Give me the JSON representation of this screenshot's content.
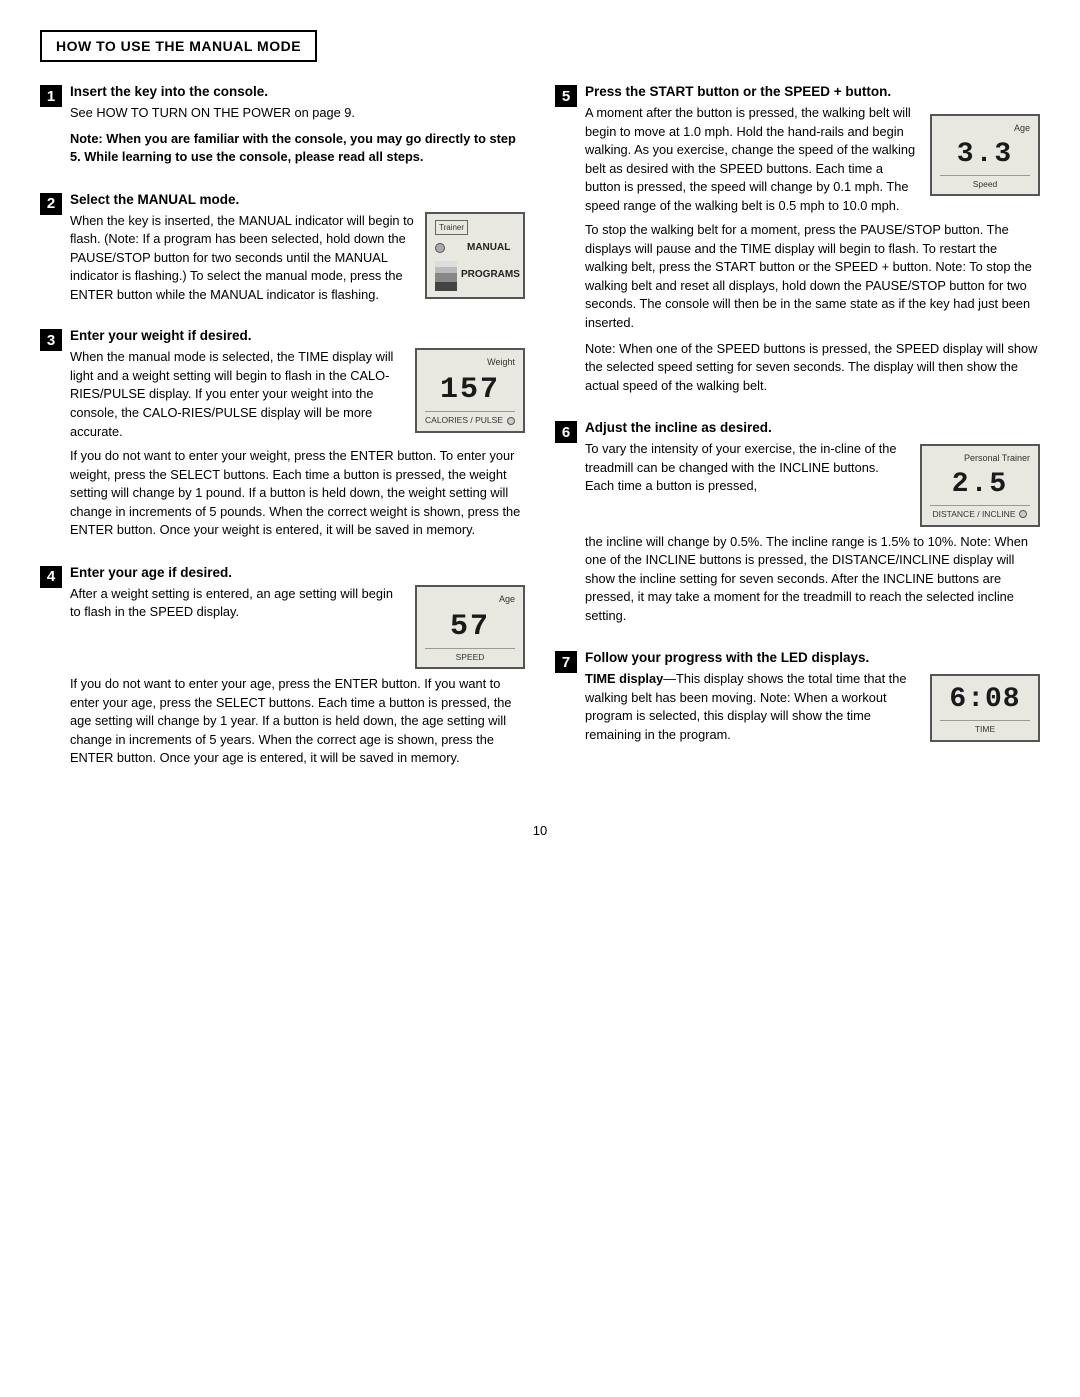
{
  "header": {
    "title": "HOW TO USE THE MANUAL MODE"
  },
  "steps": {
    "step1": {
      "title": "Insert the key into the console.",
      "body1": "See HOW TO TURN ON THE POWER on page 9.",
      "body2": "Note: When you are familiar with the console, you may go directly to step 5. While learning to use the console, please read all steps."
    },
    "step2": {
      "title": "Select the MANUAL mode.",
      "body1": "When the key is inserted, the MANUAL indicator will begin to flash. (Note: If a program has been selected, hold down the PAUSE/STOP button for two seconds until the MANUAL indicator is flashing.) To select the manual mode, press the ENTER button while the MANUAL indicator is flashing.",
      "display": {
        "trainer_label": "Trainer",
        "manual_text": "MANUAL",
        "programs_text": "PROGRAMS"
      }
    },
    "step3": {
      "title": "Enter your weight if desired.",
      "body1_before": "When the manual mode is selected, the TIME display will light and a weight setting will begin to flash in the CALO-RIES/PULSE display. If you enter your weight into the console, the CALO-RIES/PULSE display will be more accurate.",
      "display_number": "157",
      "display_label_top": "Weight",
      "display_label_bottom": "CALORIES / PULSE",
      "body2": "If you do not want to enter your weight, press the ENTER button. To enter your weight, press the SELECT buttons. Each time a button is pressed, the weight setting will change by 1 pound. If a button is held down, the weight setting will change in increments of 5 pounds. When the correct weight is shown, press the ENTER button. Once your weight is entered, it will be saved in memory."
    },
    "step4": {
      "title": "Enter your age if desired.",
      "body1": "After a weight setting is entered, an age setting will begin to flash in the SPEED display.",
      "display_number": "57",
      "display_label_top": "Age",
      "display_label_bottom": "SPEED",
      "body2": "If you do not want to enter your age, press the ENTER button. If you want to enter your age, press the SELECT buttons. Each time a button is pressed, the age setting will change by 1 year. If a button is held down, the age setting will change in increments of 5 years. When the correct age is shown, press the ENTER button. Once your age is entered, it will be saved in memory."
    },
    "step5": {
      "title": "Press the START button or the SPEED + button.",
      "body1": "A moment after the button is pressed, the walking belt will begin to move at 1.0 mph. Hold the hand-rails and begin walking. As you exercise, change the speed of the walking belt as desired with the SPEED buttons. Each time a button is pressed, the speed will change by 0.1 mph. The speed range of the walking belt is 0.5 mph to 10.0 mph.",
      "display_number": "3.3",
      "display_label_top": "Age",
      "display_label_bottom": "Speed",
      "body2": "To stop the walking belt for a moment, press the PAUSE/STOP button. The displays will pause and the TIME display will begin to flash. To restart the walking belt, press the START button or the SPEED + button. Note: To stop the walking belt and reset all displays, hold down the PAUSE/STOP button for two seconds. The console will then be in the same state as if the key had just been inserted.",
      "body3": "Note: When one of the SPEED buttons is pressed, the SPEED display will show the selected speed setting for seven seconds. The display will then show the actual speed of the walking belt."
    },
    "step6": {
      "title": "Adjust the incline as desired.",
      "body1": "To vary the intensity of your exercise, the in-cline of the treadmill can be changed with the INCLINE buttons. Each time a button is pressed,",
      "display_number": "2.5",
      "display_label_top": "Personal Trainer",
      "display_label_bottom": "DISTANCE / INCLINE",
      "body2": "the incline will change by 0.5%. The incline range is 1.5% to 10%. Note: When one of the INCLINE buttons is pressed, the DISTANCE/INCLINE display will show the incline setting for seven seconds. After the INCLINE buttons are pressed, it may take a moment for the treadmill to reach the selected incline setting."
    },
    "step7": {
      "title": "Follow your progress with the LED displays.",
      "time_display_title": "TIME display",
      "time_display_dash": "—",
      "body1": "This display shows the total time that the walking belt has been moving. Note: When a workout program is selected, this display will show the time remaining in the program.",
      "display_number": "6:08",
      "display_label_bottom": "TIME"
    }
  },
  "page_number": "10"
}
